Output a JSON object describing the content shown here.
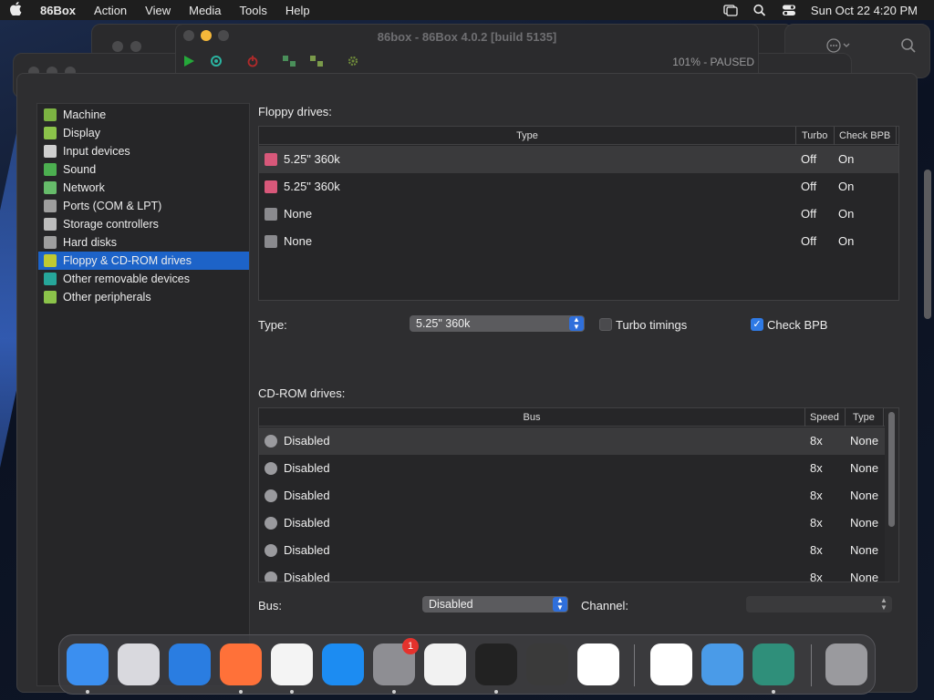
{
  "menubar": {
    "app_name": "86Box",
    "menus": [
      "Action",
      "View",
      "Media",
      "Tools",
      "Help"
    ],
    "clock": "Sun Oct 22  4:20 PM"
  },
  "emulator_window": {
    "title": "86box - 86Box 4.0.2 [build 5135]",
    "status": "101% - PAUSED"
  },
  "sidebar": {
    "items": [
      {
        "label": "Machine",
        "icon": "machine-icon",
        "color": "#7cb342"
      },
      {
        "label": "Display",
        "icon": "display-icon",
        "color": "#8bc34a"
      },
      {
        "label": "Input devices",
        "icon": "input-devices-icon",
        "color": "#cfcfcf"
      },
      {
        "label": "Sound",
        "icon": "sound-icon",
        "color": "#4caf50"
      },
      {
        "label": "Network",
        "icon": "network-icon",
        "color": "#66bb6a"
      },
      {
        "label": "Ports (COM & LPT)",
        "icon": "ports-icon",
        "color": "#9e9e9e"
      },
      {
        "label": "Storage controllers",
        "icon": "storage-controllers-icon",
        "color": "#bdbdbd"
      },
      {
        "label": "Hard disks",
        "icon": "hard-disks-icon",
        "color": "#9e9e9e"
      },
      {
        "label": "Floppy & CD-ROM drives",
        "icon": "floppy-cdrom-icon",
        "color": "#c0ca33"
      },
      {
        "label": "Other removable devices",
        "icon": "removable-devices-icon",
        "color": "#26a69a"
      },
      {
        "label": "Other peripherals",
        "icon": "peripherals-icon",
        "color": "#8bc34a"
      }
    ],
    "selected_index": 8
  },
  "floppy": {
    "section_label": "Floppy drives:",
    "columns": [
      "Type",
      "Turbo",
      "Check BPB"
    ],
    "rows": [
      {
        "type": "5.25\" 360k",
        "turbo": "Off",
        "check_bpb": "On"
      },
      {
        "type": "5.25\" 360k",
        "turbo": "Off",
        "check_bpb": "On"
      },
      {
        "type": "None",
        "turbo": "Off",
        "check_bpb": "On"
      },
      {
        "type": "None",
        "turbo": "Off",
        "check_bpb": "On"
      }
    ],
    "type_label": "Type:",
    "type_value": "5.25\" 360k",
    "turbo_label": "Turbo timings",
    "turbo_checked": false,
    "check_bpb_label": "Check BPB",
    "check_bpb_checked": true
  },
  "cdrom": {
    "section_label": "CD-ROM drives:",
    "columns": [
      "Bus",
      "Speed",
      "Type"
    ],
    "rows": [
      {
        "bus": "Disabled",
        "speed": "8x",
        "type": "None"
      },
      {
        "bus": "Disabled",
        "speed": "8x",
        "type": "None"
      },
      {
        "bus": "Disabled",
        "speed": "8x",
        "type": "None"
      },
      {
        "bus": "Disabled",
        "speed": "8x",
        "type": "None"
      },
      {
        "bus": "Disabled",
        "speed": "8x",
        "type": "None"
      },
      {
        "bus": "Disabled",
        "speed": "8x",
        "type": "None"
      }
    ],
    "bus_label": "Bus:",
    "bus_value": "Disabled",
    "channel_label": "Channel:",
    "channel_value": ""
  },
  "dock": {
    "apps": [
      {
        "name": "finder",
        "color": "#3b8ff0",
        "running": true
      },
      {
        "name": "launchpad",
        "color": "#d9d9de",
        "running": false
      },
      {
        "name": "safari",
        "color": "#2a7de1",
        "running": false
      },
      {
        "name": "firefox",
        "color": "#ff7139",
        "running": true
      },
      {
        "name": "chrome",
        "color": "#f4f4f4",
        "running": true
      },
      {
        "name": "app-store",
        "color": "#1c8cf2",
        "running": false
      },
      {
        "name": "system-settings",
        "color": "#8e8e93",
        "running": true,
        "badge": "1"
      },
      {
        "name": "textedit",
        "color": "#f2f2f2",
        "running": false
      },
      {
        "name": "terminal",
        "color": "#222222",
        "running": true
      },
      {
        "name": "garageband",
        "color": "#3a3a3a",
        "running": false
      },
      {
        "name": "vscode",
        "color": "#ffffff",
        "running": false
      },
      {
        "name": "visual-studio",
        "color": "#ffffff",
        "running": false
      },
      {
        "name": "weather",
        "color": "#4a9be8",
        "running": false
      },
      {
        "name": "86box",
        "color": "#2f8f7a",
        "running": true
      },
      {
        "name": "trash",
        "color": "#9a9a9e",
        "running": false
      }
    ]
  }
}
